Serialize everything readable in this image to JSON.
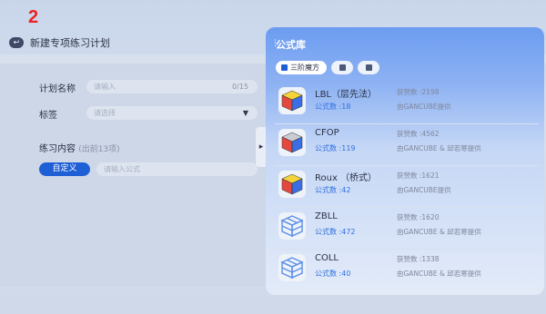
{
  "step_number": "2",
  "header": {
    "title": "新建专项练习计划",
    "back_icon": "back-icon"
  },
  "form": {
    "plan_name_label": "计划名称",
    "plan_name_placeholder": "请输入",
    "plan_name_counter": "0/15",
    "tags_label": "标签",
    "tags_placeholder": "请选择",
    "practice_label": "练习内容",
    "practice_sub": "(出前13项)",
    "custom_button": "自定义",
    "formula_placeholder": "请输入公式"
  },
  "library": {
    "title": "公式库",
    "tabs": [
      {
        "label": "三阶魔方",
        "active": true
      },
      {
        "label": "",
        "active": false
      },
      {
        "label": "",
        "active": false
      }
    ],
    "items": [
      {
        "name": "LBL（层先法）",
        "count": "公式数 :18",
        "likes": "获赞数 :2198",
        "source": "由GANCUBE提供",
        "icon": "rubiks-cube-icon"
      },
      {
        "name": "CFOP",
        "count": "公式数 :119",
        "likes": "获赞数 :4562",
        "source": "由GANCUBE & 邱若寒提供",
        "icon": "rubiks-cube-icon"
      },
      {
        "name": "Roux （桥式）",
        "count": "公式数 :42",
        "likes": "获赞数 :1621",
        "source": "由GANCUBE提供",
        "icon": "rubiks-cube-icon"
      },
      {
        "name": "ZBLL",
        "count": "公式数 :472",
        "likes": "获赞数 :1620",
        "source": "由GANCUBE & 邱若寒提供",
        "icon": "cube-blueprint-icon"
      },
      {
        "name": "COLL",
        "count": "公式数 :40",
        "likes": "获赞数 :1338",
        "source": "由GANCUBE & 邱若寒提供",
        "icon": "cube-blueprint-icon"
      }
    ]
  },
  "colors": {
    "accent": "#1f5fd6",
    "panel": "#6c9cf0",
    "red": "#ee2222"
  }
}
